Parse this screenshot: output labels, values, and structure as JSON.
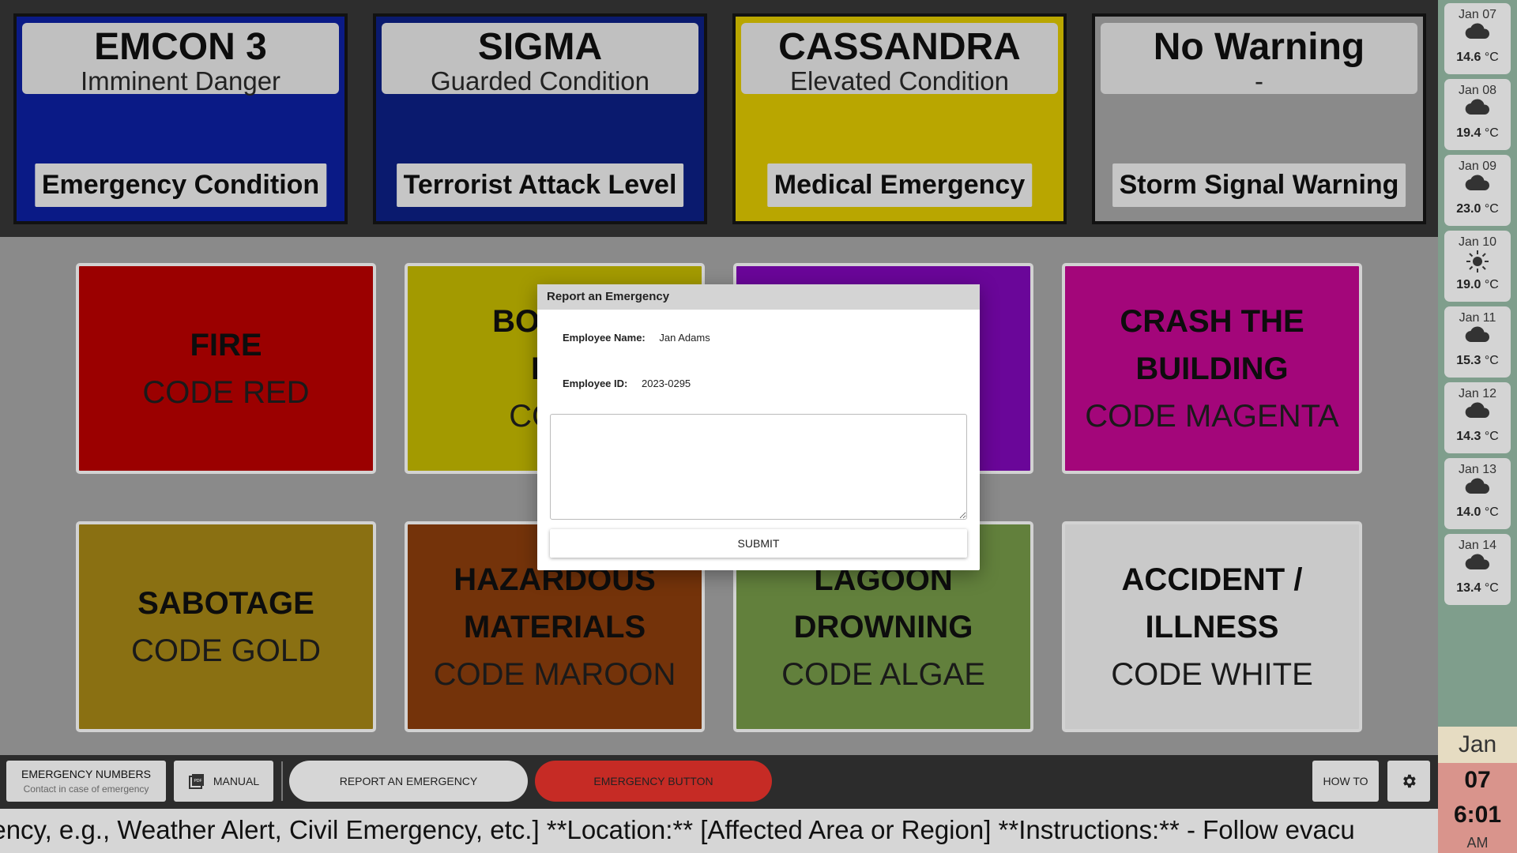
{
  "status_panels": [
    {
      "title": "EMCON 3",
      "subtitle": "Imminent Danger",
      "label": "Emergency Condition",
      "color": "#0a1a86"
    },
    {
      "title": "SIGMA",
      "subtitle": "Guarded Condition",
      "label": "Terrorist Attack Level",
      "color": "#0a1a6e"
    },
    {
      "title": "CASSANDRA",
      "subtitle": "Elevated Condition",
      "label": "Medical Emergency",
      "color": "#b9a600"
    },
    {
      "title": "No Warning",
      "subtitle": "-",
      "label": "Storm Signal Warning",
      "color": "#8a8a8a"
    }
  ],
  "tiles": [
    {
      "name": "FIRE",
      "code": "CODE RED",
      "color": "#9b0000"
    },
    {
      "name": "BOMB T",
      "name2": "BO",
      "code": "CODE",
      "color": "#a39a00"
    },
    {
      "name": "",
      "code": "",
      "color": "#6a0699"
    },
    {
      "name": "CRASH THE",
      "name2": "BUILDING",
      "code": "CODE MAGENTA",
      "color": "#a3067a"
    },
    {
      "name": "SABOTAGE",
      "code": "CODE GOLD",
      "color": "#8a7012"
    },
    {
      "name": "HAZARDOUS",
      "name2": "MATERIALS",
      "code": "CODE MAROON",
      "color": "#74330a"
    },
    {
      "name": "LAGOON",
      "name2": "DROWNING",
      "code": "CODE ALGAE",
      "color": "#62803c"
    },
    {
      "name": "ACCIDENT /",
      "name2": "ILLNESS",
      "code": "CODE WHITE",
      "color": "#c9c9c9"
    }
  ],
  "weather": [
    {
      "date": "Jan 07",
      "icon": "cloud-icon",
      "temp": "14.6",
      "unit": "°C"
    },
    {
      "date": "Jan 08",
      "icon": "cloud-icon",
      "temp": "19.4",
      "unit": "°C"
    },
    {
      "date": "Jan 09",
      "icon": "cloud-icon",
      "temp": "23.0",
      "unit": "°C"
    },
    {
      "date": "Jan 10",
      "icon": "sun-icon",
      "temp": "19.0",
      "unit": "°C"
    },
    {
      "date": "Jan 11",
      "icon": "cloud-icon",
      "temp": "15.3",
      "unit": "°C"
    },
    {
      "date": "Jan 12",
      "icon": "cloud-icon",
      "temp": "14.3",
      "unit": "°C"
    },
    {
      "date": "Jan 13",
      "icon": "cloud-icon",
      "temp": "14.0",
      "unit": "°C"
    },
    {
      "date": "Jan 14",
      "icon": "cloud-icon",
      "temp": "13.4",
      "unit": "°C"
    }
  ],
  "clock": {
    "month": "Jan",
    "day": "07",
    "time": "6:01",
    "ampm": "AM"
  },
  "toolbar": {
    "numbers_title": "EMERGENCY NUMBERS",
    "numbers_sub": "Contact in case of emergency",
    "manual_label": "MANUAL",
    "manual_icon": "pdf-icon",
    "report_label": "REPORT AN EMERGENCY",
    "emergency_label": "EMERGENCY BUTTON",
    "howto_label": "HOW TO",
    "settings_icon": "gear-icon"
  },
  "ticker": {
    "text": "rgency, e.g., Weather Alert, Civil Emergency, etc.] **Location:** [Affected Area or Region] **Instructions:** - Follow evacu"
  },
  "modal": {
    "title": "Report an Emergency",
    "employee_name_label": "Employee Name:",
    "employee_name": "Jan Adams",
    "employee_id_label": "Employee ID:",
    "employee_id": "2023-0295",
    "textarea_value": "",
    "submit_label": "SUBMIT"
  }
}
